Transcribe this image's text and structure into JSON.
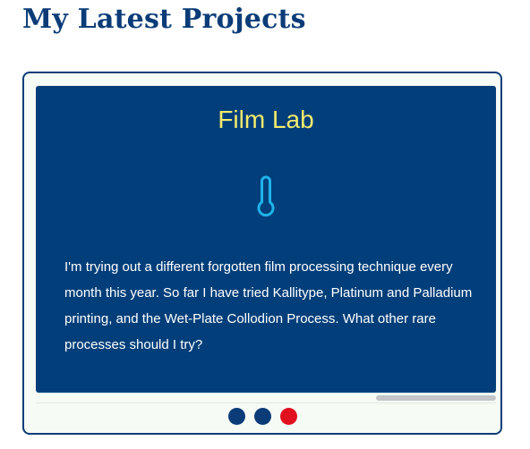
{
  "header": {
    "title": "My Latest Projects"
  },
  "carousel": {
    "slide": {
      "title": "Film Lab",
      "icon": "thermometer-icon",
      "description": "I'm trying out a different forgotten film processing technique every month this year. So far I have tried Kallitype, Platinum and Palladium printing, and the Wet-Plate Collodion Process. What other rare processes should I try?"
    },
    "scroll_position": 1.0,
    "dots": [
      {
        "label": "slide 1",
        "color": "#0b3c78",
        "active": false
      },
      {
        "label": "slide 2",
        "color": "#0b3c78",
        "active": false
      },
      {
        "label": "slide 3",
        "color": "#e0101f",
        "active": true
      }
    ],
    "colors": {
      "frame": "#0b3c78",
      "slide_background": "#023f7a",
      "slide_title": "#f5ea6c",
      "icon": "#1fb3ea",
      "text": "#ffffff",
      "active_dot": "#e0101f"
    }
  }
}
